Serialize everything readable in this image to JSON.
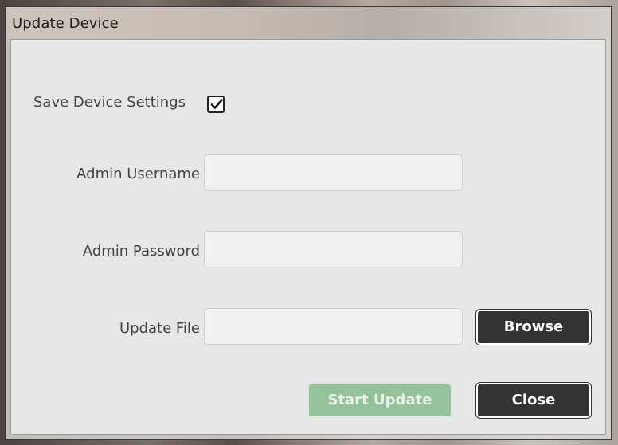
{
  "window": {
    "title": "Update Device"
  },
  "form": {
    "save_settings_label": "Save Device Settings",
    "save_settings_checked": true,
    "username_label": "Admin Username",
    "username_value": "",
    "password_label": "Admin Password",
    "password_value": "",
    "file_label": "Update File",
    "file_value": ""
  },
  "buttons": {
    "browse": "Browse",
    "start_update": "Start Update",
    "close": "Close"
  },
  "colors": {
    "dark_button": "#333333",
    "disabled_green": "#95c29a",
    "panel": "#e7e7e7"
  },
  "icons": {
    "checkbox": "checkmark-icon"
  }
}
